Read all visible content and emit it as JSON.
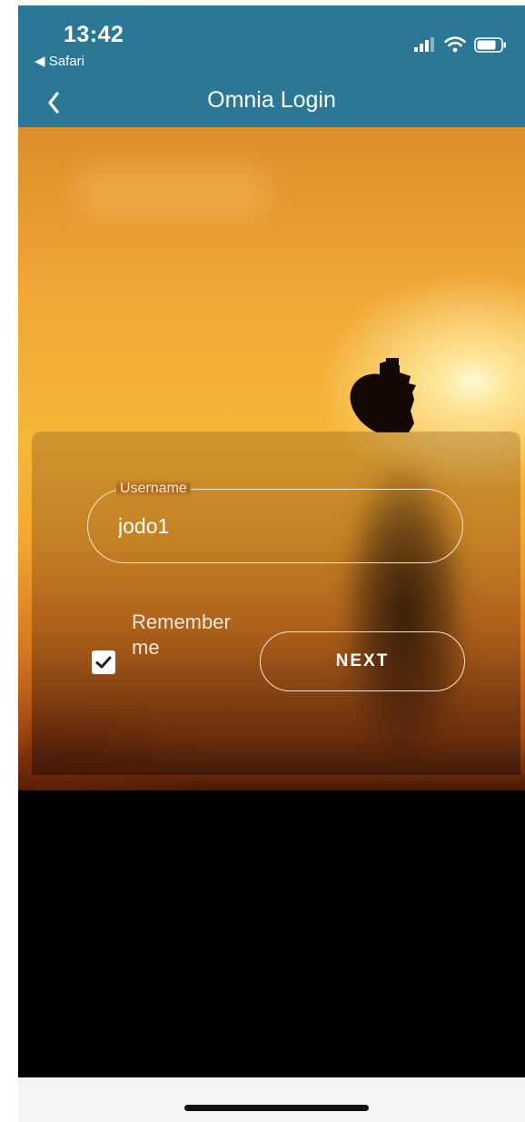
{
  "status_bar": {
    "time": "13:42",
    "back_app": "Safari"
  },
  "nav": {
    "title": "Omnia Login",
    "back_icon": "chevron-left-icon"
  },
  "login": {
    "username_label": "Username",
    "username_value": "jodo1",
    "remember_label": "Remember me",
    "remember_checked": true,
    "next_label": "NEXT"
  },
  "colors": {
    "nav_bar": "#2b7896",
    "field_border": "#f3e6d5"
  }
}
